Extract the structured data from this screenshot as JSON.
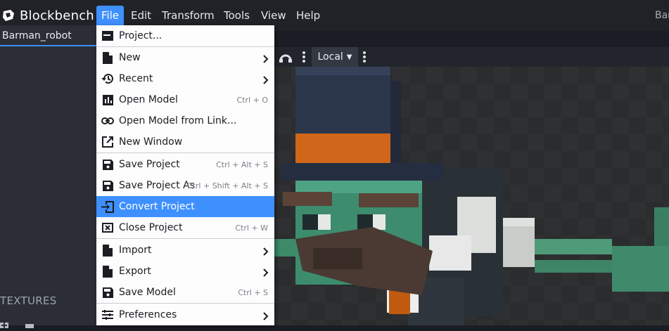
{
  "app": {
    "name": "Blockbench",
    "window_title": "Barman_robot"
  },
  "menubar": [
    {
      "label": "File",
      "active": true
    },
    {
      "label": "Edit"
    },
    {
      "label": "Transform"
    },
    {
      "label": "Tools"
    },
    {
      "label": "View"
    },
    {
      "label": "Help"
    }
  ],
  "left_panel": {
    "project_tab": "Barman_robot",
    "textures_heading": "TEXTURES"
  },
  "viewport_toolbar": {
    "space_select": "Local"
  },
  "file_menu": [
    {
      "label": "Project...",
      "icon": "project-icon"
    },
    {
      "label": "New",
      "icon": "new-file-icon",
      "submenu": true
    },
    {
      "label": "Recent",
      "icon": "history-icon",
      "submenu": true
    },
    {
      "label": "Open Model",
      "icon": "open-model-icon",
      "shortcut": "Ctrl + O"
    },
    {
      "label": "Open Model from Link...",
      "icon": "link-icon"
    },
    {
      "label": "New Window",
      "icon": "open-in-new-icon"
    },
    {
      "label": "Save Project",
      "icon": "save-icon",
      "shortcut": "Ctrl + Alt + S"
    },
    {
      "label": "Save Project As",
      "icon": "save-as-icon",
      "shortcut": "Ctrl + Shift + Alt + S"
    },
    {
      "label": "Convert Project",
      "icon": "convert-icon",
      "highlighted": true
    },
    {
      "label": "Close Project",
      "icon": "close-box-icon",
      "shortcut": "Ctrl + W"
    },
    {
      "label": "Import",
      "icon": "import-icon",
      "submenu": true
    },
    {
      "label": "Export",
      "icon": "export-icon",
      "submenu": true
    },
    {
      "label": "Save Model",
      "icon": "save-model-icon",
      "shortcut": "Ctrl + S"
    },
    {
      "label": "Preferences",
      "icon": "tune-icon",
      "submenu": true
    }
  ],
  "colors": {
    "accent": "#3e90ff",
    "menu_bg": "#fdfdfd",
    "app_bg": "#1b1d24"
  }
}
